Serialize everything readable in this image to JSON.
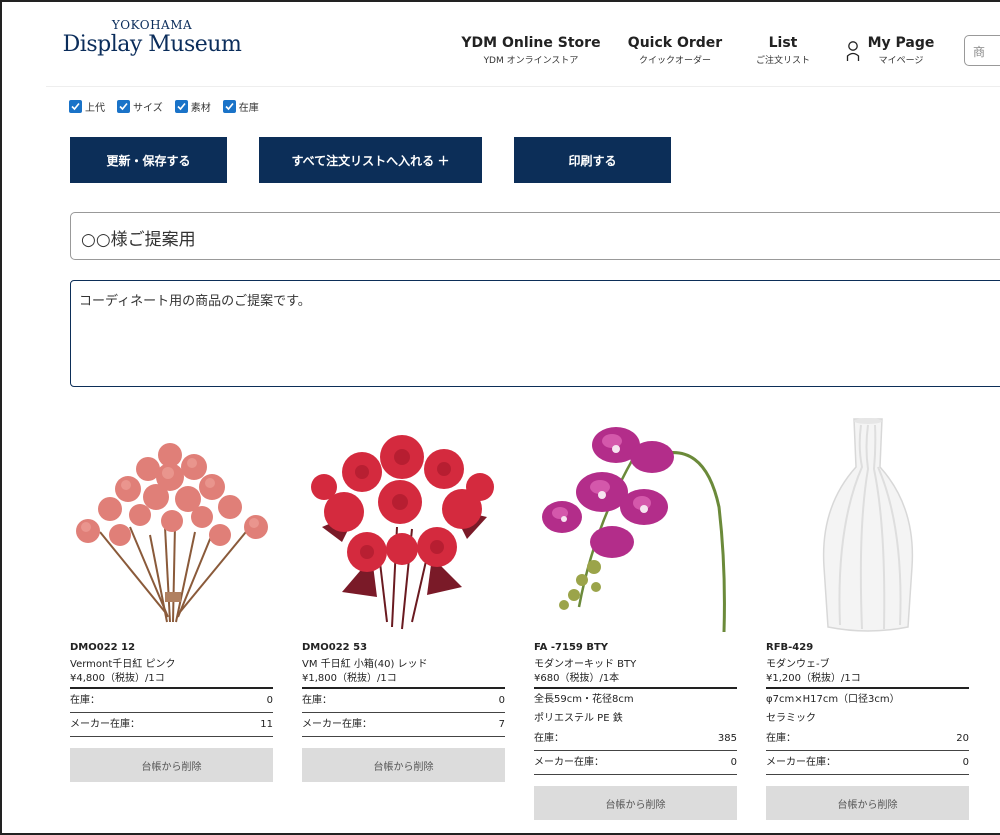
{
  "header": {
    "logo_top": "YOKOHAMA",
    "logo_main": "Display Museum",
    "nav": [
      {
        "label": "YDM Online Store",
        "sub": "YDM オンラインストア"
      },
      {
        "label": "Quick Order",
        "sub": "クイックオーダー"
      },
      {
        "label": "List",
        "sub": "ご注文リスト"
      },
      {
        "label": "My Page",
        "sub": "マイページ"
      }
    ],
    "search_placeholder": "商"
  },
  "filters": [
    "上代",
    "サイズ",
    "素材",
    "在庫"
  ],
  "actions": {
    "save": "更新・保存する",
    "add_all": "すべて注文リストへ入れる ＋",
    "print": "印刷する"
  },
  "list_title": "○○様ご提案用",
  "memo": "コーディネート用の商品のご提案です。",
  "labels": {
    "stock": "在庫：",
    "maker_stock": "メーカー在庫：",
    "remove": "台帳から削除"
  },
  "products": [
    {
      "code": "DMO022 12",
      "name": "Vermont千日紅 ピンク",
      "price": "¥4,800（税抜）/1コ",
      "specs": [],
      "stock": "0",
      "maker_stock": "11"
    },
    {
      "code": "DMO022 53",
      "name": "VM 千日紅 小箱(40) レッド",
      "price": "¥1,800（税抜）/1コ",
      "specs": [],
      "stock": "0",
      "maker_stock": "7"
    },
    {
      "code": "FA -7159 BTY",
      "name": "モダンオーキッド BTY",
      "price": "¥680（税抜）/1本",
      "specs": [
        "全長59cm・花径8cm",
        "ポリエステル PE 鉄"
      ],
      "stock": "385",
      "maker_stock": "0"
    },
    {
      "code": "RFB-429",
      "name": "モダンウェ-ブ",
      "price": "¥1,200（税抜）/1コ",
      "specs": [
        "φ7cm×H17cm（口径3cm）",
        "セラミック"
      ],
      "stock": "20",
      "maker_stock": "0"
    }
  ],
  "colors": {
    "navy": "#0c2e58",
    "checkbox": "#1a73c8",
    "remove_button": "#dcdcdc"
  }
}
